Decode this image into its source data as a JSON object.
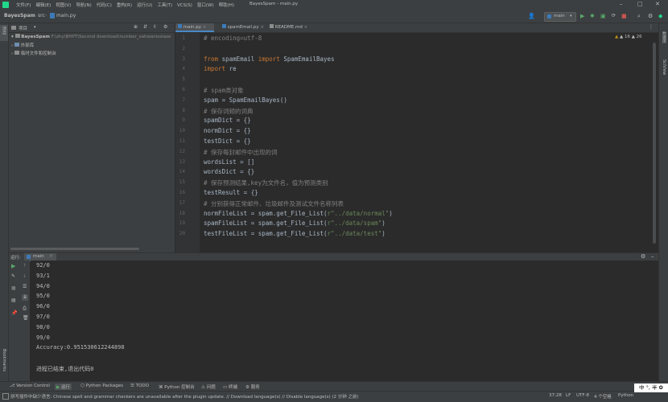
{
  "titlebar": {
    "menus": [
      "文件(F)",
      "编辑(E)",
      "视图(V)",
      "导航(N)",
      "代码(C)",
      "重构(R)",
      "运行(U)",
      "工具(T)",
      "VCS(S)",
      "窗口(W)",
      "帮助(H)"
    ],
    "window_title": "BayesSpam - main.py"
  },
  "navbar": {
    "breadcrumb": [
      "BayesSpam",
      "src",
      "main.py"
    ],
    "run_config": "main"
  },
  "left_stripe": {
    "project_label": "项目",
    "structure_label": "结构",
    "bookmarks_label": "Bookmarks"
  },
  "right_stripe": {
    "database_label": "数据库",
    "scview_label": "SciView"
  },
  "project": {
    "header_label": "项目",
    "root_name": "BayesSpam",
    "root_path": "F:\\zhy\\BHPT\\Second download\\number_sahwanisslaxe",
    "external_libs": "外部库",
    "scratches": "临时文件和控制台"
  },
  "editor": {
    "tabs": [
      "main.py",
      "spamEmail.py",
      "README.md"
    ],
    "inspection": "▲ 16  ▲ 26",
    "lines": [
      {
        "n": "1",
        "segs": [
          {
            "t": "# encoding=utf-8",
            "c": "cm"
          }
        ]
      },
      {
        "n": "2",
        "segs": []
      },
      {
        "n": "3",
        "segs": [
          {
            "t": "from ",
            "c": "kw"
          },
          {
            "t": "spamEmail ",
            "c": ""
          },
          {
            "t": "import ",
            "c": "kw"
          },
          {
            "t": "SpamEmailBayes",
            "c": ""
          }
        ]
      },
      {
        "n": "4",
        "segs": [
          {
            "t": "import ",
            "c": "kw"
          },
          {
            "t": "re",
            "c": ""
          }
        ]
      },
      {
        "n": "5",
        "segs": []
      },
      {
        "n": "6",
        "segs": [
          {
            "t": "# spam类对象",
            "c": "cm"
          }
        ]
      },
      {
        "n": "7",
        "segs": [
          {
            "t": "spam = SpamEmailBayes()",
            "c": ""
          }
        ]
      },
      {
        "n": "8",
        "segs": [
          {
            "t": "# 保存词频的词典",
            "c": "cm"
          }
        ]
      },
      {
        "n": "9",
        "segs": [
          {
            "t": "spamDict = {}",
            "c": ""
          }
        ]
      },
      {
        "n": "10",
        "segs": [
          {
            "t": "normDict = {}",
            "c": ""
          }
        ]
      },
      {
        "n": "11",
        "segs": [
          {
            "t": "testDict = {}",
            "c": ""
          }
        ]
      },
      {
        "n": "12",
        "segs": [
          {
            "t": "# 保存每封邮件中出现的词",
            "c": "cm"
          }
        ]
      },
      {
        "n": "13",
        "segs": [
          {
            "t": "wordsList = []",
            "c": ""
          }
        ]
      },
      {
        "n": "14",
        "segs": [
          {
            "t": "wordsDict = {}",
            "c": ""
          }
        ]
      },
      {
        "n": "15",
        "segs": [
          {
            "t": "# 保存预测结果,key为文件名，值为预测类别",
            "c": "cm"
          }
        ]
      },
      {
        "n": "16",
        "segs": [
          {
            "t": "testResult = {}",
            "c": ""
          }
        ]
      },
      {
        "n": "17",
        "segs": [
          {
            "t": "# 分别获得正常邮件、垃圾邮件及测试文件名称列表",
            "c": "cm"
          }
        ]
      },
      {
        "n": "18",
        "segs": [
          {
            "t": "normFileList = spam.get_File_List(",
            "c": ""
          },
          {
            "t": "r\"../data/normal\"",
            "c": "st"
          },
          {
            "t": ")",
            "c": ""
          }
        ]
      },
      {
        "n": "19",
        "segs": [
          {
            "t": "spamFileList = spam.get_File_List(",
            "c": ""
          },
          {
            "t": "r\"../data/spam\"",
            "c": "st"
          },
          {
            "t": ")",
            "c": ""
          }
        ]
      },
      {
        "n": "20",
        "segs": [
          {
            "t": "testFileList = spam.get_File_List(",
            "c": ""
          },
          {
            "t": "r\"../data/test\"",
            "c": "st"
          },
          {
            "t": ")",
            "c": ""
          }
        ]
      }
    ]
  },
  "run_panel": {
    "label": "运行:",
    "tab": "main",
    "output": [
      "92/0",
      "93/1",
      "94/0",
      "95/0",
      "96/0",
      "97/0",
      "98/0",
      "99/0",
      "Accuracy:0.951530612244898",
      "",
      "进程已结束,退出代码0"
    ]
  },
  "bottom_tools": [
    "Version Control",
    "运行",
    "Python Packages",
    "TODO",
    "Python 控制台",
    "问题",
    "终端",
    "服务"
  ],
  "status": {
    "message": "拼写插件中缺少语言: Chinese spell and grammar checkers are unavailable after the plugin update. // Download language(s) // Disable language(s) (2 分钟 之前)",
    "position": "37:28",
    "line_sep": "LF",
    "encoding": "UTF-8",
    "indent": "4 个空格",
    "interpreter": "Python",
    "ime": "中 °, 半 ✿"
  },
  "colors": {
    "accent": "#4a88c7",
    "run_green": "#59a869",
    "keyword": "#cc7832",
    "comment": "#808080",
    "string": "#6a8759"
  }
}
